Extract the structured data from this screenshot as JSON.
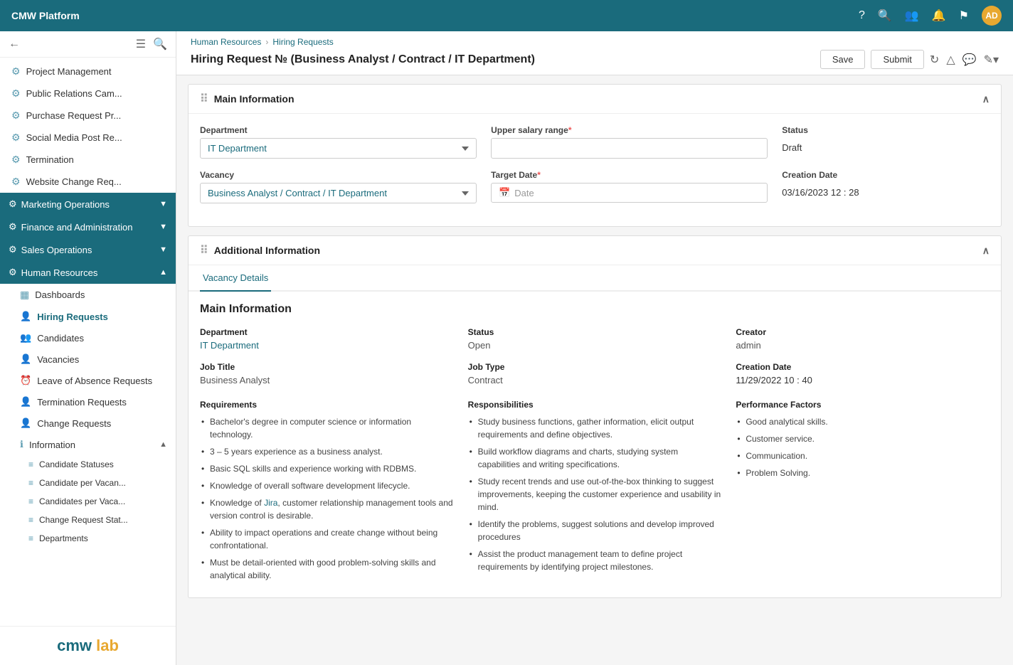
{
  "topNav": {
    "title": "CMW Platform",
    "avatar": "AD"
  },
  "sidebar": {
    "backArrow": "←",
    "items": [
      {
        "id": "project-management",
        "icon": "⚙",
        "label": "Project Management"
      },
      {
        "id": "public-relations",
        "icon": "⚙",
        "label": "Public Relations Cam..."
      },
      {
        "id": "purchase-request",
        "icon": "⚙",
        "label": "Purchase Request Pr..."
      },
      {
        "id": "social-media",
        "icon": "⚙",
        "label": "Social Media Post Re..."
      },
      {
        "id": "termination",
        "icon": "⚙",
        "label": "Termination"
      },
      {
        "id": "website-change",
        "icon": "⚙",
        "label": "Website Change Req..."
      }
    ],
    "categories": [
      {
        "id": "marketing-ops",
        "label": "Marketing Operations",
        "chevron": "▼"
      },
      {
        "id": "finance-admin",
        "label": "Finance and Administration",
        "chevron": "▼"
      },
      {
        "id": "sales-ops",
        "label": "Sales Operations",
        "chevron": "▼"
      },
      {
        "id": "human-resources",
        "label": "Human Resources",
        "chevron": "▲"
      }
    ],
    "hrSubItems": [
      {
        "id": "dashboards",
        "icon": "▦",
        "label": "Dashboards"
      },
      {
        "id": "hiring-requests",
        "icon": "👤+",
        "label": "Hiring Requests",
        "active": true
      },
      {
        "id": "candidates",
        "icon": "👥",
        "label": "Candidates"
      },
      {
        "id": "vacancies",
        "icon": "👤",
        "label": "Vacancies"
      },
      {
        "id": "leave-absence",
        "icon": "🕐",
        "label": "Leave of Absence Requests"
      },
      {
        "id": "termination-requests",
        "icon": "👤",
        "label": "Termination Requests"
      },
      {
        "id": "change-requests",
        "icon": "👤",
        "label": "Change Requests"
      }
    ],
    "infoSection": {
      "label": "Information",
      "chevron": "▲",
      "subItems": [
        {
          "id": "candidate-statuses",
          "label": "Candidate Statuses"
        },
        {
          "id": "candidate-per-vacan",
          "label": "Candidate per Vacan..."
        },
        {
          "id": "candidates-per-vaca",
          "label": "Candidates per Vaca..."
        },
        {
          "id": "change-request-stat",
          "label": "Change Request Stat..."
        },
        {
          "id": "departments",
          "label": "Departments"
        }
      ]
    },
    "logoText": "cmw",
    "logoAccent": "lab"
  },
  "breadcrumb": {
    "parent": "Human Resources",
    "child": "Hiring Requests"
  },
  "pageTitle": "Hiring Request № (Business Analyst / Contract / IT Department)",
  "actions": {
    "save": "Save",
    "submit": "Submit"
  },
  "mainInfo": {
    "sectionTitle": "Main Information",
    "departmentLabel": "Department",
    "departmentValue": "IT Department",
    "upperSalaryLabel": "Upper salary range",
    "statusLabel": "Status",
    "statusValue": "Draft",
    "vacancyLabel": "Vacancy",
    "vacancyValue": "Business Analyst / Contract / IT Department",
    "targetDateLabel": "Target Date",
    "targetDatePlaceholder": "Date",
    "creationDateLabel": "Creation Date",
    "creationDateValue": "03/16/2023   12 : 28"
  },
  "additionalInfo": {
    "sectionTitle": "Additional Information",
    "tab": "Vacancy Details"
  },
  "vacancyDetails": {
    "title": "Main Information",
    "departmentLabel": "Department",
    "departmentValue": "IT Department",
    "statusLabel": "Status",
    "statusValue": "Open",
    "creatorLabel": "Creator",
    "creatorValue": "admin",
    "jobTitleLabel": "Job Title",
    "jobTitleValue": "Business Analyst",
    "jobTypeLabel": "Job Type",
    "jobTypeValue": "Contract",
    "creationDateLabel": "Creation Date",
    "creationDateValue": "11/29/2022   10 : 40",
    "requirementsLabel": "Requirements",
    "requirements": [
      "Bachelor's degree in computer science or information technology.",
      "3 – 5 years experience as a business analyst.",
      "Basic SQL skills and experience working with RDBMS.",
      "Knowledge of overall software development lifecycle.",
      "Knowledge of Jira, customer relationship management tools and version control is desirable.",
      "Ability to impact operations and create change without being confrontational.",
      "Must be detail-oriented with good problem-solving skills and analytical ability."
    ],
    "responsibilitiesLabel": "Responsibilities",
    "responsibilities": [
      "Study business functions, gather information, elicit output requirements and define objectives.",
      "Build workflow diagrams and charts, studying system capabilities and writing specifications.",
      "Study recent trends and use out-of-the-box thinking to suggest improvements, keeping the customer experience and usability in mind.",
      "Identify the problems, suggest solutions and develop improved procedures",
      "Assist the product management team to define project requirements by identifying project milestones."
    ],
    "performanceLabel": "Performance Factors",
    "performance": [
      "Good analytical skills.",
      "Customer service.",
      "Communication.",
      "Problem Solving."
    ]
  }
}
